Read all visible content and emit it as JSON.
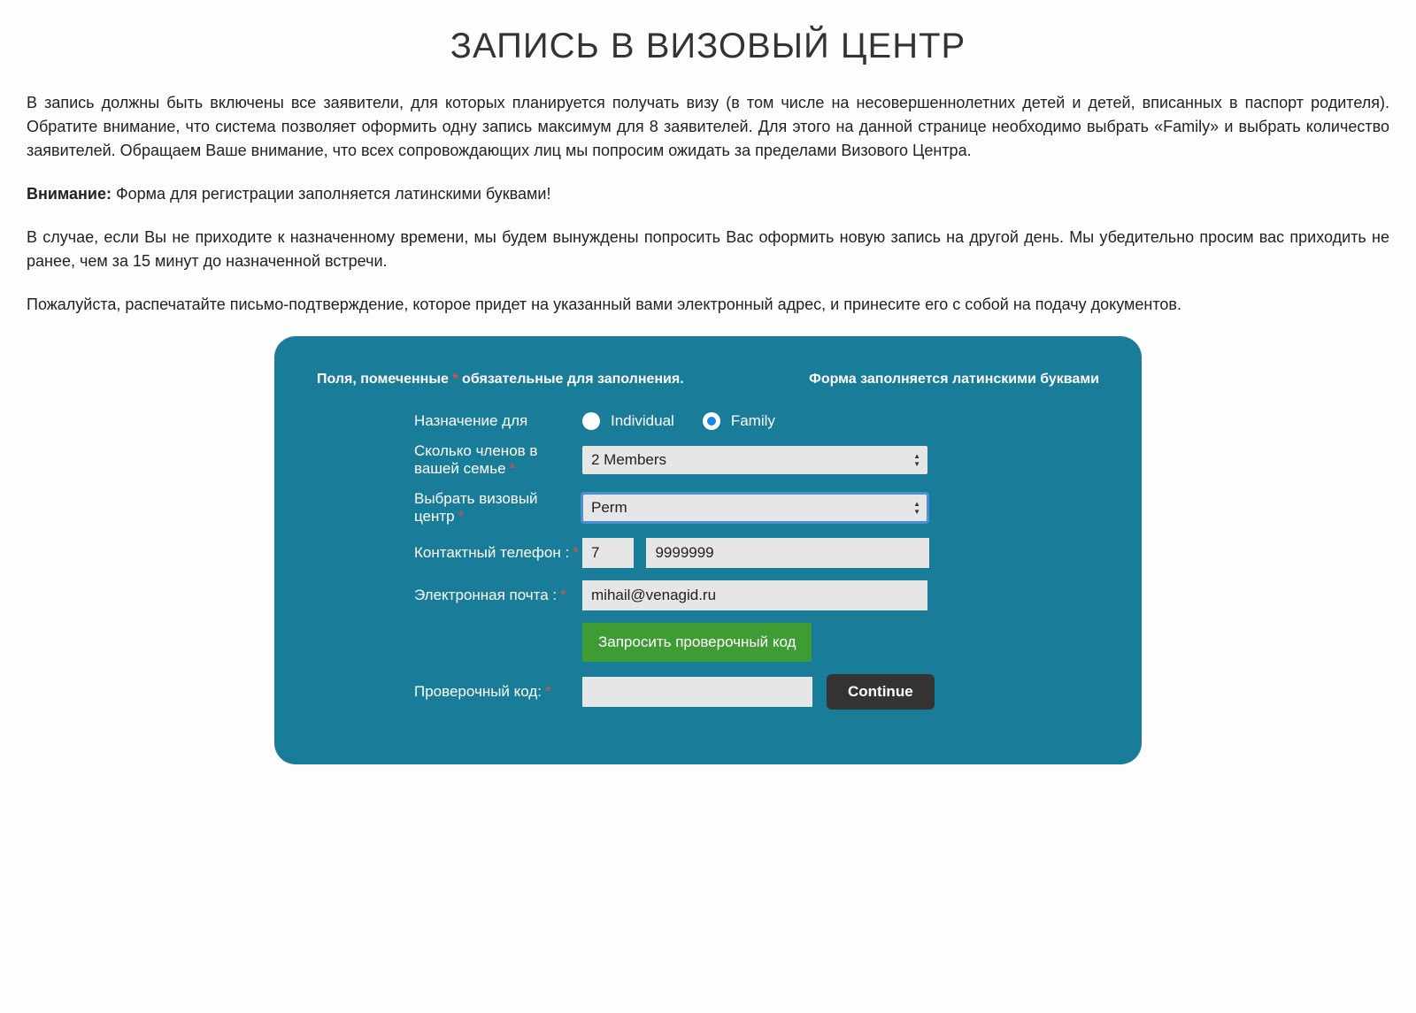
{
  "page": {
    "title": "ЗАПИСЬ В ВИЗОВЫЙ ЦЕНТР",
    "paragraph1": "В запись должны быть включены все заявители, для которых планируется получать визу (в том числе на несовершеннолетних детей и детей, вписанных в паспорт родителя). Обратите внимание, что система позволяет оформить одну запись максимум для 8 заявителей. Для этого на данной странице необходимо выбрать «Family» и выбрать количество заявителей. Обращаем Ваше внимание, что всех сопровождающих лиц мы попросим ожидать за пределами Визового Центра.",
    "attention_label": "Внимание:",
    "attention_text": " Форма для регистрации заполняется латинскими буквами!",
    "paragraph3": "В случае, если Вы не приходите к назначенному времени, мы будем вынуждены попросить Вас оформить новую запись на другой день. Мы убедительно просим вас приходить не ранее, чем за 15 минут до назначенной встречи.",
    "paragraph4": "Пожалуйста, распечатайте письмо-подтверждение, которое придет на указанный вами электронный адрес, и принесите его с собой на подачу документов."
  },
  "form": {
    "header_left_pre": "Поля, помеченные ",
    "header_left_star": "*",
    "header_left_post": " обязательные для заполнения.",
    "header_right": "Форма заполняется латинскими буквами",
    "labels": {
      "appointment_for": "Назначение для",
      "family_members": "Сколько членов в вашей семье",
      "visa_center": "Выбрать визовый центр",
      "phone": "Контактный телефон :",
      "email": "Электронная почта :",
      "verify_code": "Проверочный код:"
    },
    "radio": {
      "individual": "Individual",
      "family": "Family",
      "selected": "family"
    },
    "members_value": "2 Members",
    "visa_center_value": "Perm",
    "phone_cc": "7",
    "phone_number": "9999999",
    "email_value": "mihail@venagid.ru",
    "code_value": "",
    "request_code_btn": "Запросить проверочный код",
    "continue_btn": "Continue",
    "required_marker": "*"
  },
  "colors": {
    "panel_bg": "#197c99",
    "accent_green": "#3f9c35",
    "required_red": "#e74c3c"
  }
}
